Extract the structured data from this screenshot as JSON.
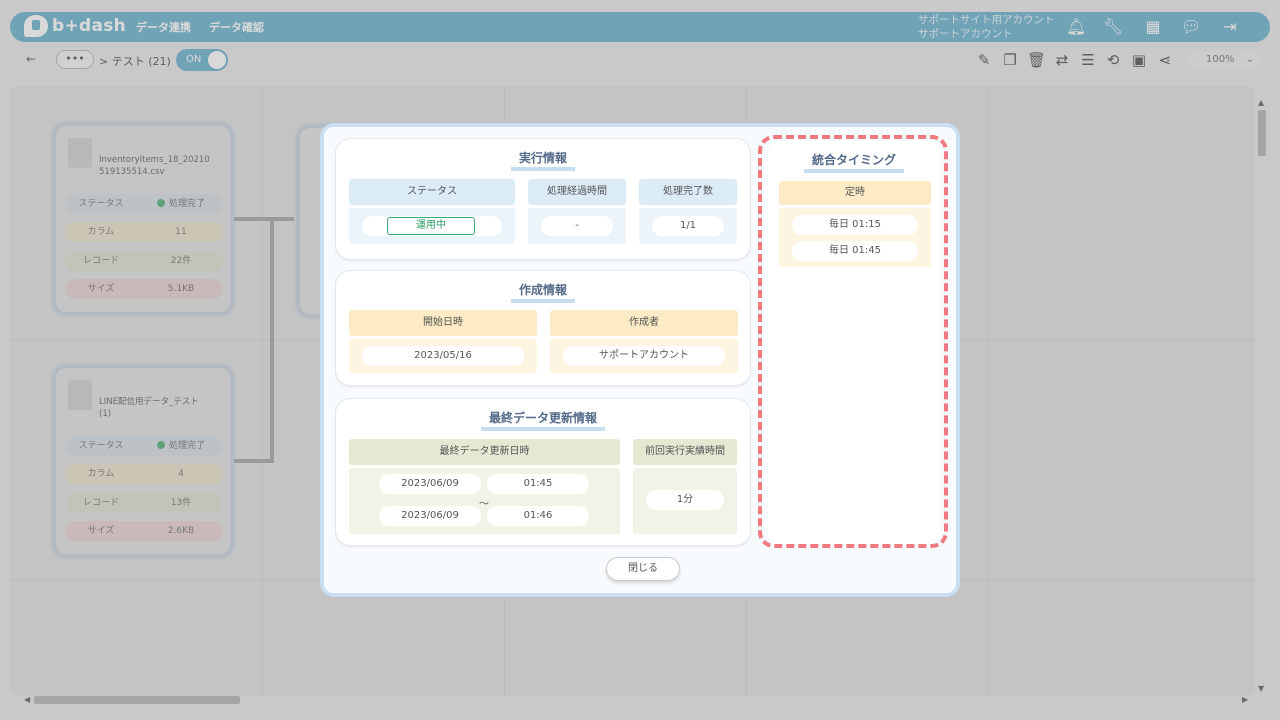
{
  "app": {
    "brand": "b+dash",
    "nav": [
      "データ連携",
      "データ確認"
    ],
    "account_line1": "サポートサイト用アカウント",
    "account_line2": "サポートアカウント"
  },
  "toolbar": {
    "back_icon": "arrow-left-icon",
    "crumb_more": "•••",
    "breadcrumb": "> テスト (21)",
    "toggle": "ON",
    "zoom": "100%"
  },
  "nodes": [
    {
      "name_line1": "InventoryItems_18_20210",
      "name_line2": "519135514.csv",
      "rows": [
        {
          "k": "ステータス",
          "v": "処理完了"
        },
        {
          "k": "カラム",
          "v": "11"
        },
        {
          "k": "レコード",
          "v": "22件"
        },
        {
          "k": "サイズ",
          "v": "5.1KB"
        }
      ]
    },
    {
      "name_line1": "LINE配信用データ_テスト",
      "name_line2": "(1)",
      "rows": [
        {
          "k": "ステータス",
          "v": "処理完了"
        },
        {
          "k": "カラム",
          "v": "4"
        },
        {
          "k": "レコード",
          "v": "13件"
        },
        {
          "k": "サイズ",
          "v": "2.6KB"
        }
      ]
    }
  ],
  "modal": {
    "exec": {
      "title": "実行情報",
      "headers": [
        "ステータス",
        "処理経過時間",
        "処理完了数"
      ],
      "status": "運用中",
      "elapsed": "-",
      "count": "1/1"
    },
    "create": {
      "title": "作成情報",
      "headers": [
        "開始日時",
        "作成者"
      ],
      "start": "2023/05/16",
      "creator": "サポートアカウント"
    },
    "last": {
      "title": "最終データ更新情報",
      "headers": [
        "最終データ更新日時",
        "前回実行実績時間"
      ],
      "from_date": "2023/06/09",
      "from_time": "01:45",
      "tilde": "～",
      "to_date": "2023/06/09",
      "to_time": "01:46",
      "duration": "1分"
    },
    "timing": {
      "title": "統合タイミング",
      "header": "定時",
      "items": [
        "毎日 01:15",
        "毎日 01:45"
      ]
    },
    "close": "閉じる"
  },
  "colors": {
    "brand": "#6fb4d0",
    "highlight": "#f07880",
    "status_green": "#3bab73"
  }
}
